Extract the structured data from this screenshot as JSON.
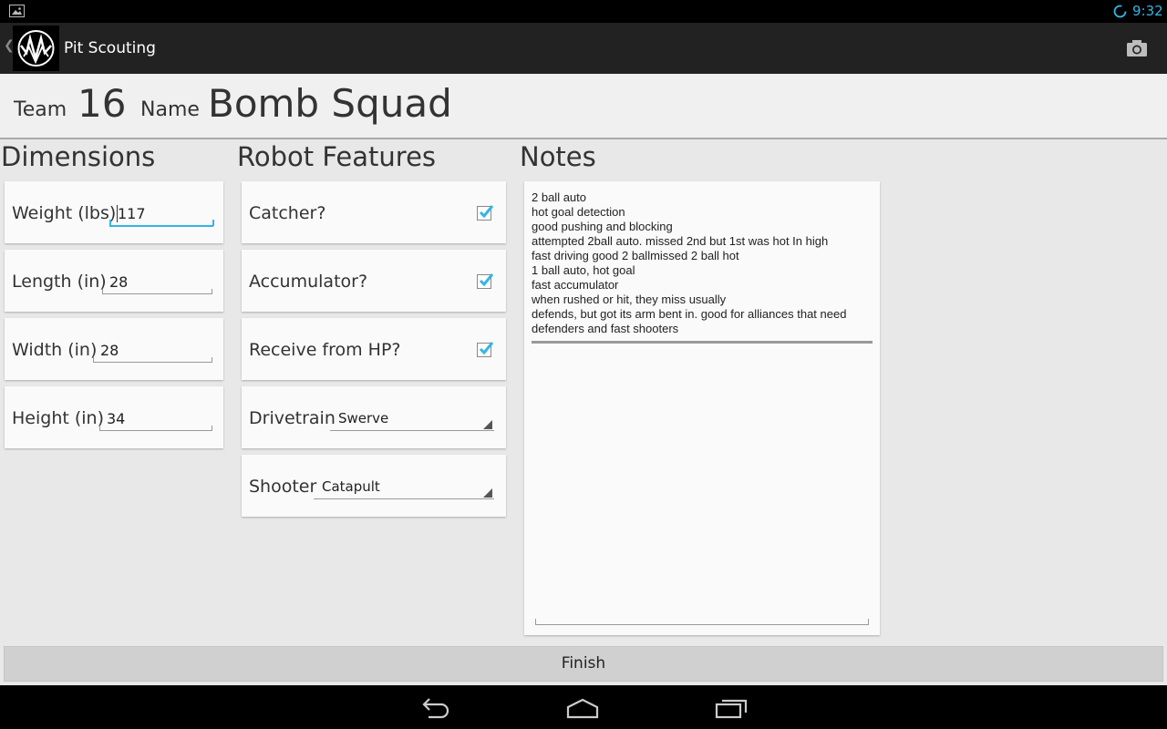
{
  "status_bar": {
    "time": "9:32",
    "icons": [
      "gallery-icon",
      "sync-spinner-icon"
    ],
    "accent_color": "#33b5e5"
  },
  "action_bar": {
    "title": "Pit Scouting",
    "icons": [
      "back-caret-icon",
      "team-logo",
      "camera-icon"
    ]
  },
  "header": {
    "team_label": "Team",
    "team_number": "16",
    "name_label": "Name",
    "team_name": "Bomb Squad"
  },
  "dimensions": {
    "title": "Dimensions",
    "fields": [
      {
        "label": "Weight (lbs)",
        "value": "117",
        "focused": true
      },
      {
        "label": "Length (in)",
        "value": "28"
      },
      {
        "label": "Width (in)",
        "value": "28"
      },
      {
        "label": "Height (in)",
        "value": "34"
      }
    ]
  },
  "features": {
    "title": "Robot Features",
    "checkboxes": [
      {
        "label": "Catcher?",
        "checked": true
      },
      {
        "label": "Accumulator?",
        "checked": true
      },
      {
        "label": "Receive from HP?",
        "checked": true
      }
    ],
    "drivetrain": {
      "label": "Drivetrain",
      "selected": "Swerve"
    },
    "shooter": {
      "label": "Shooter",
      "selected": "Catapult"
    }
  },
  "notes": {
    "title": "Notes",
    "lines": [
      "2 ball auto",
      "hot goal detection",
      "good pushing and blocking",
      "attempted 2ball auto. missed 2nd but 1st was hot In high",
      "fast driving good 2 ballmissed 2 ball hot",
      "1 ball auto, hot goal",
      "fast accumulator",
      "when rushed or hit, they miss usually",
      "defends, but got its arm bent in. good for alliances that need",
      "defenders and fast shooters"
    ]
  },
  "finish_label": "Finish",
  "nav_bar": {
    "icons": [
      "back-icon",
      "home-icon",
      "recent-apps-icon"
    ]
  }
}
